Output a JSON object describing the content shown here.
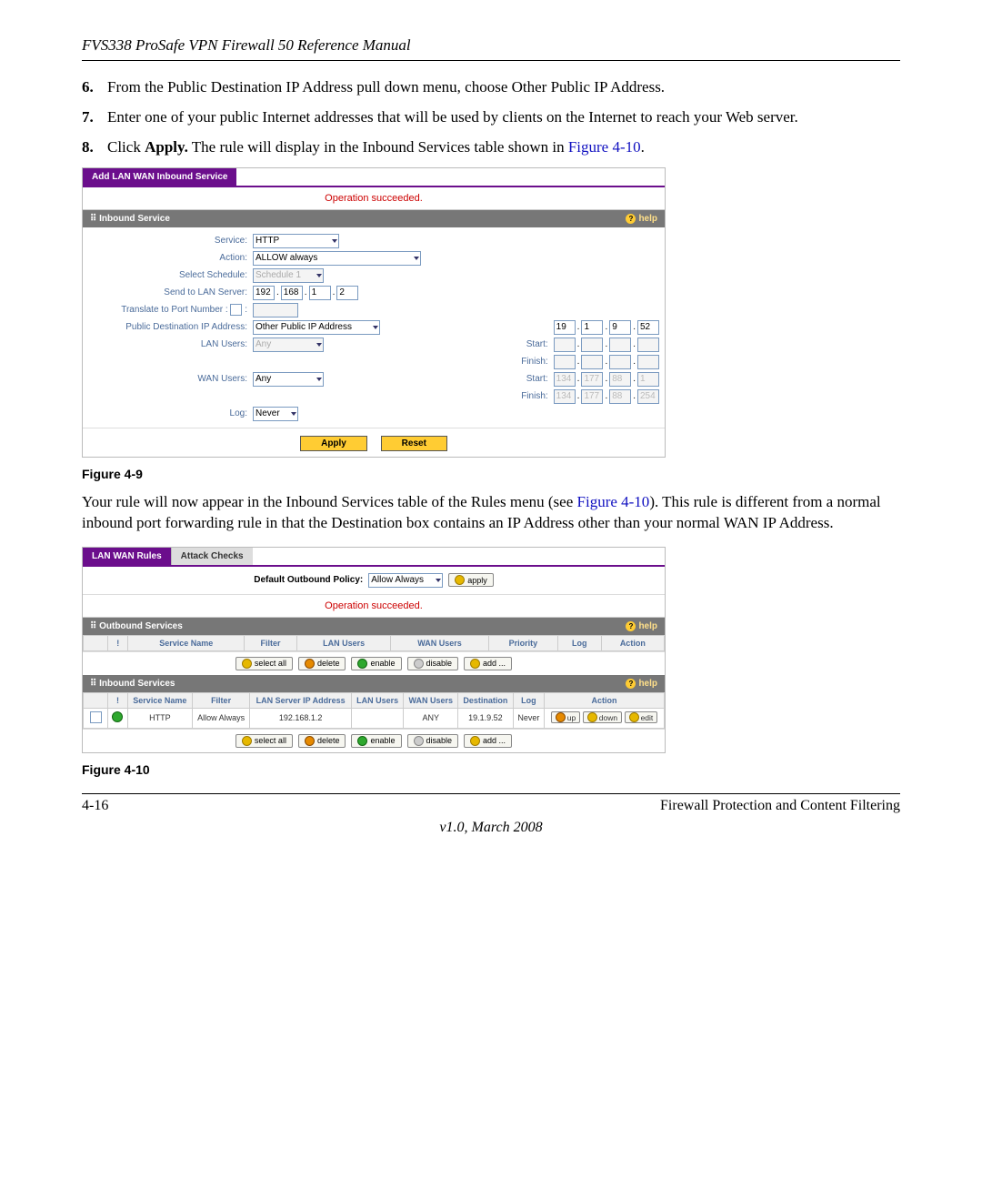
{
  "doc": {
    "header": "FVS338 ProSafe VPN Firewall 50 Reference Manual",
    "steps": {
      "s6_num": "6.",
      "s6": "From the Public Destination IP Address pull down menu, choose Other Public IP Address.",
      "s7_num": "7.",
      "s7": "Enter one of your public Internet addresses that will be used by clients on the Internet to reach your Web server.",
      "s8_num": "8.",
      "s8_a": "Click ",
      "s8_b": "Apply.",
      "s8_c": " The rule will display in the Inbound Services table shown in ",
      "s8_ref": "Figure 4-10",
      "s8_d": "."
    },
    "fig9_caption": "Figure 4-9",
    "mid_para_a": "Your rule will now appear in the Inbound Services table of the Rules menu (see ",
    "mid_para_ref": "Figure 4-10",
    "mid_para_b": "). This rule is different from a normal inbound port forwarding rule in that the Destination box contains an IP Address other than your normal WAN IP Address.",
    "fig10_caption": "Figure 4-10",
    "page": "4-16",
    "footer_section": "Firewall Protection and Content Filtering",
    "version": "v1.0, March 2008"
  },
  "fig9": {
    "tab": "Add LAN WAN Inbound Service",
    "status": "Operation succeeded.",
    "section": "Inbound Service",
    "help": "help",
    "labels": {
      "service": "Service:",
      "action": "Action:",
      "schedule": "Select Schedule:",
      "send_lan": "Send to LAN Server:",
      "translate": "Translate to Port Number      :",
      "pub_dest": "Public Destination IP Address:",
      "lan_users": "LAN Users:",
      "wan_users": "WAN Users:",
      "log": "Log:",
      "start": "Start:",
      "finish": "Finish:"
    },
    "values": {
      "service": "HTTP",
      "action": "ALLOW always",
      "schedule": "Schedule 1",
      "lan_ip": [
        "192",
        "168",
        "1",
        "2"
      ],
      "pub_dest": "Other Public IP Address",
      "pub_ip": [
        "19",
        "1",
        "9",
        "52"
      ],
      "lan_users": "Any",
      "wan_users": "Any",
      "wan_start": [
        "134",
        "177",
        "88",
        "1"
      ],
      "wan_finish": [
        "134",
        "177",
        "88",
        "254"
      ],
      "log": "Never"
    },
    "buttons": {
      "apply": "Apply",
      "reset": "Reset"
    }
  },
  "fig10": {
    "tab1": "LAN WAN Rules",
    "tab2": "Attack Checks",
    "policy_label": "Default Outbound Policy:",
    "policy_value": "Allow Always",
    "apply": "apply",
    "status": "Operation succeeded.",
    "outbound_title": "Outbound Services",
    "inbound_title": "Inbound Services",
    "help": "help",
    "out_headers": [
      "!",
      "Service Name",
      "Filter",
      "LAN Users",
      "WAN Users",
      "Priority",
      "Log",
      "Action"
    ],
    "in_headers": [
      "!",
      "Service Name",
      "Filter",
      "LAN Server IP Address",
      "LAN Users",
      "WAN Users",
      "Destination",
      "Log",
      "Action"
    ],
    "in_row": {
      "service": "HTTP",
      "filter": "Allow Always",
      "lan_ip": "192.168.1.2",
      "lan_users": "",
      "wan_users": "ANY",
      "dest": "19.1.9.52",
      "log": "Never"
    },
    "row_actions": {
      "up": "up",
      "down": "down",
      "edit": "edit"
    },
    "actions": {
      "select_all": "select all",
      "delete": "delete",
      "enable": "enable",
      "disable": "disable",
      "add": "add ..."
    }
  }
}
